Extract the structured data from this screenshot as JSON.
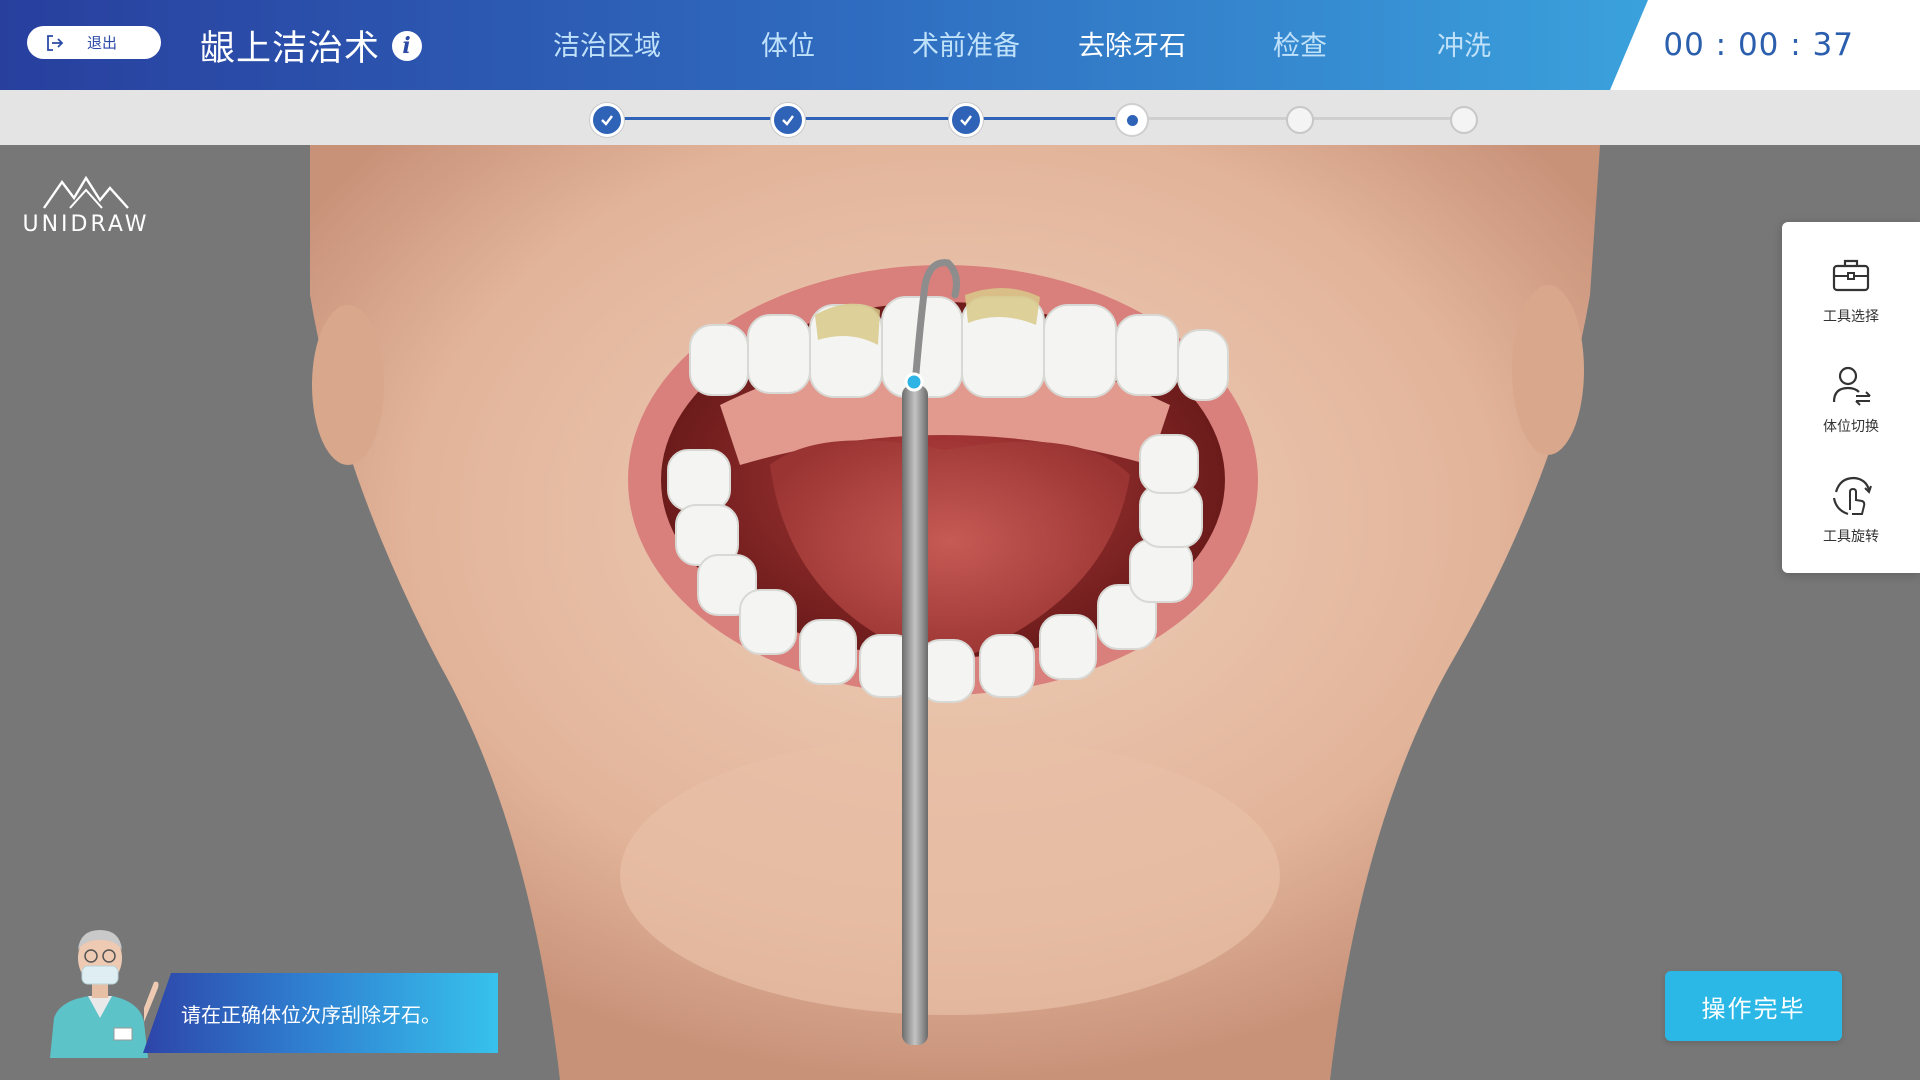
{
  "header": {
    "exit_label": "退出",
    "title": "龈上洁治术",
    "nav": [
      {
        "label": "洁治区域",
        "state": "done"
      },
      {
        "label": "体位",
        "state": "done"
      },
      {
        "label": "术前准备",
        "state": "done"
      },
      {
        "label": "去除牙石",
        "state": "active"
      },
      {
        "label": "检查",
        "state": "todo"
      },
      {
        "label": "冲洗",
        "state": "todo"
      }
    ],
    "timer": "00 : 00 : 37"
  },
  "progress": {
    "completed_steps": 3,
    "current_step": 4,
    "total_steps": 6
  },
  "logo": {
    "text": "UNIDRAW"
  },
  "toolbar": {
    "items": [
      {
        "label": "工具选择",
        "icon": "toolbox-icon"
      },
      {
        "label": "体位切换",
        "icon": "person-switch-icon"
      },
      {
        "label": "工具旋转",
        "icon": "rotate-hand-icon"
      }
    ]
  },
  "hint": {
    "text": "请在正确体位次序刮除牙石。"
  },
  "actions": {
    "done_label": "操作完毕"
  },
  "colors": {
    "primary": "#2e63b7",
    "accent": "#2bb8e6",
    "header_start": "#283f9e",
    "header_end": "#3fb4e6"
  }
}
